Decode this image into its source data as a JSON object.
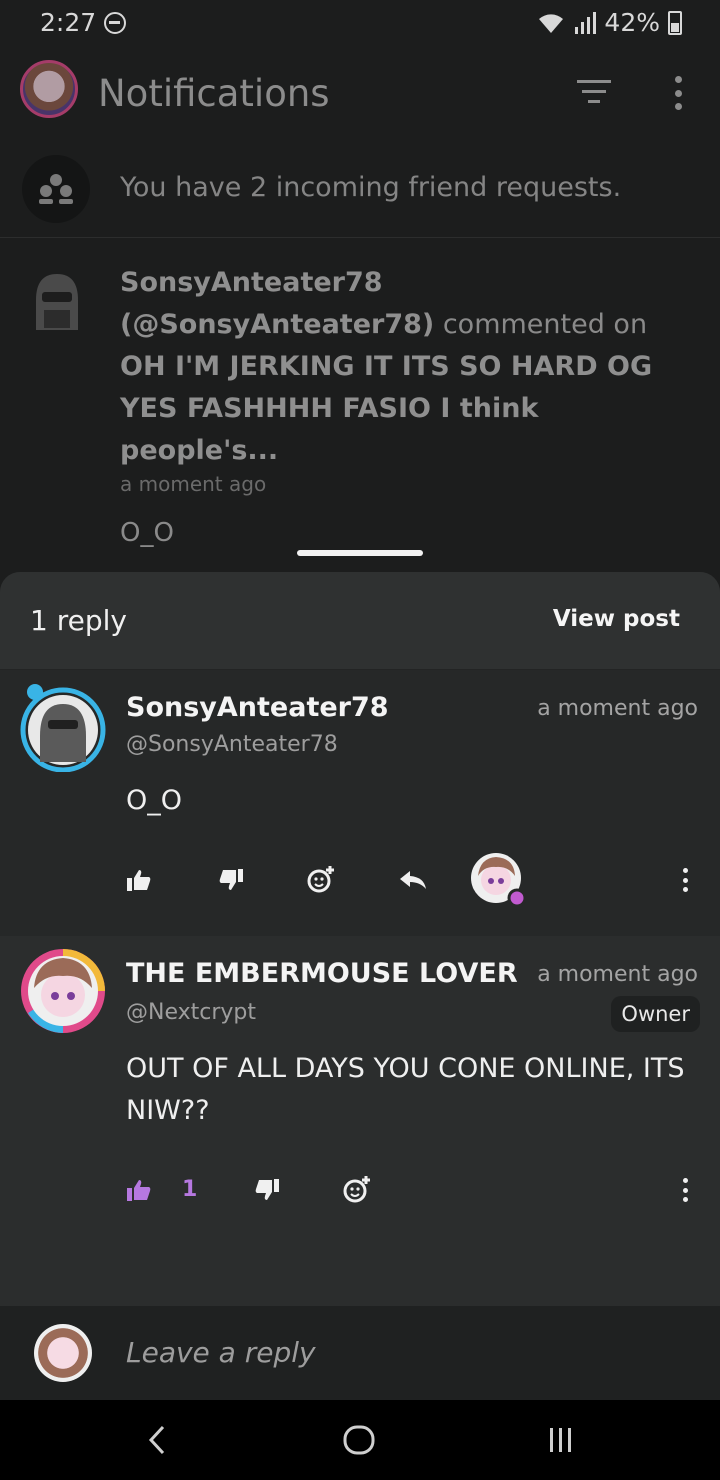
{
  "status": {
    "time": "2:27",
    "battery": "42%"
  },
  "app_bar": {
    "title": "Notifications"
  },
  "friend_requests": {
    "text": "You have 2 incoming friend requests."
  },
  "notification": {
    "username": "SonsyAnteater78",
    "handle_paren": "(@SonsyAnteater78)",
    "action": "commented on",
    "post_excerpt": "OH I'M JERKING IT ITS SO HARD OG YES FASHHHH FASIO I think people's...",
    "time": "a moment ago",
    "snippet": "O_O"
  },
  "sheet": {
    "reply_count": "1 reply",
    "view_post_label": "View post"
  },
  "comments": [
    {
      "name": "SonsyAnteater78",
      "handle": "@SonsyAnteater78",
      "time": "a moment ago",
      "text": "O_O"
    },
    {
      "name": "THE EMBERMOUSE LOVER",
      "handle": "@Nextcrypt",
      "time": "a moment ago",
      "badge": "Owner",
      "text": "OUT OF ALL DAYS YOU CONE ONLINE, ITS NIW??",
      "likes": "1"
    }
  ],
  "reply_input": {
    "placeholder": "Leave a reply"
  },
  "colors": {
    "accent_like": "#b678e0",
    "sheet_bg": "#2b2d2d",
    "avatar_ring_cyan": "#39b4e6",
    "avatar_ring_pink": "#e04a8a"
  },
  "icons": [
    "thumbs-up-icon",
    "thumbs-down-icon",
    "add-reaction-icon",
    "reply-icon",
    "more-vert-icon",
    "filter-icon",
    "friends-icon",
    "back-icon",
    "home-icon",
    "recents-icon"
  ]
}
